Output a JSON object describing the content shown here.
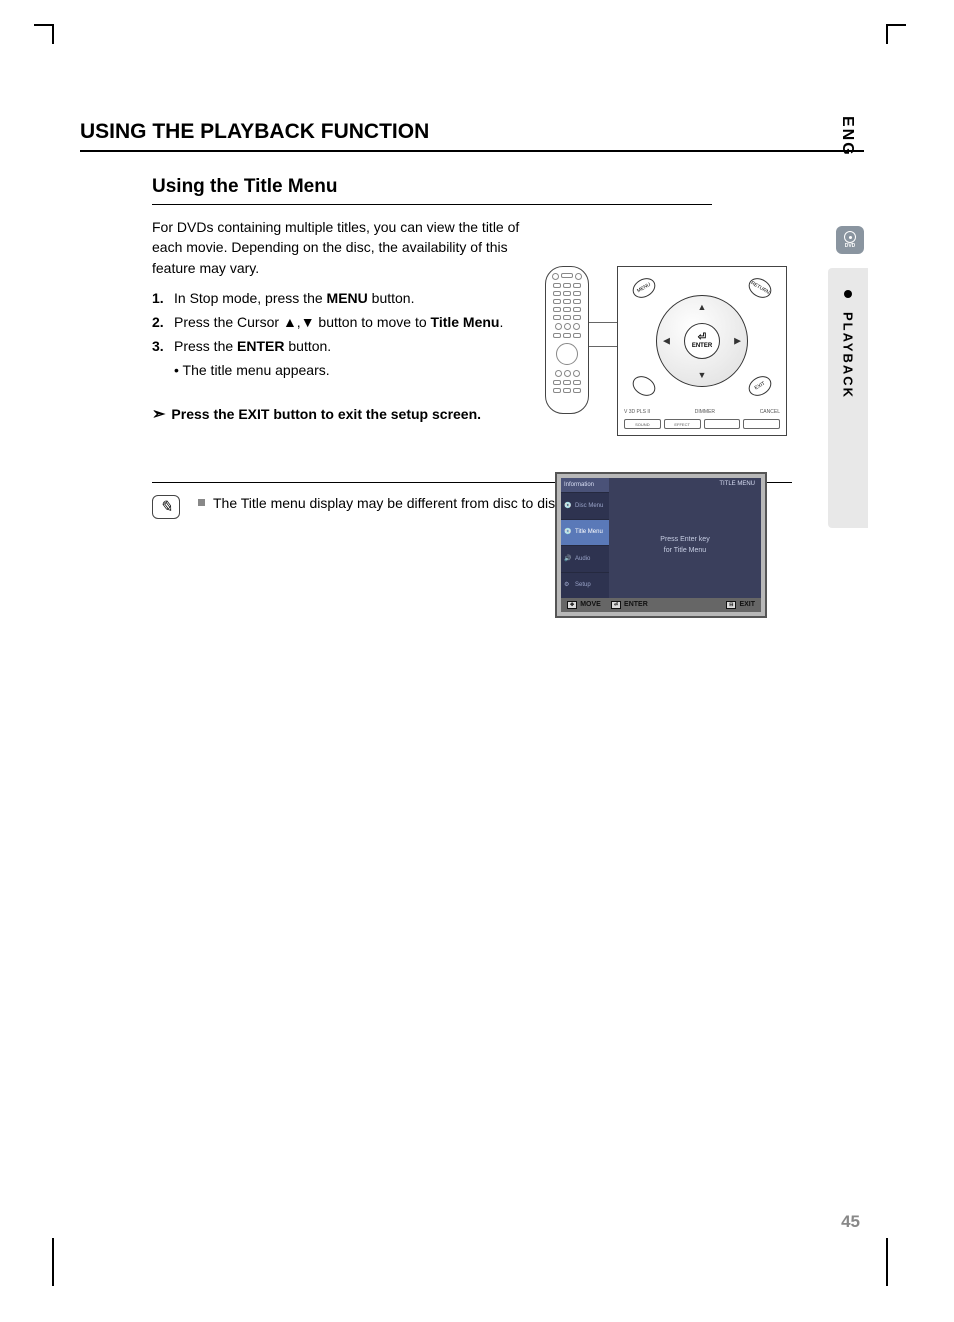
{
  "lang_tab": "ENG",
  "side_tab": "PLAYBACK",
  "dvd_badge": "DVD",
  "heading1": "USING THE PLAYBACK FUNCTION",
  "heading2": "Using the Title Menu",
  "intro": "For DVDs containing multiple titles, you can view the title of each movie. Depending on the disc, the availability of this feature may vary.",
  "steps": [
    {
      "num": "1.",
      "pre": "In Stop mode, press the ",
      "bold": "MENU",
      "post": " button."
    },
    {
      "num": "2.",
      "pre": "Press the Cursor ",
      "mid": ",",
      "bold": "Title Menu",
      "post_pre": " button to move to ",
      "post": "."
    },
    {
      "num": "3.",
      "pre": "Press the ",
      "bold": "ENTER",
      "post": " button."
    }
  ],
  "sub_bullet": "• The title menu appears.",
  "exit_line": "Press the EXIT button to exit the setup screen.",
  "dpad": {
    "enter": "ENTER",
    "menu": "MENU",
    "return": "RETURN",
    "exit": "EXIT",
    "bottom_labels": [
      "V 3D PLS II",
      "DIMMER",
      "CANCEL"
    ],
    "bottom_buttons": [
      "SOUND",
      "EFFECT",
      "",
      ""
    ]
  },
  "tv": {
    "header": "Information",
    "title_right": "TITLE MENU",
    "side_items": [
      "Disc Menu",
      "Title Menu",
      "Audio",
      "Setup"
    ],
    "main_line1": "Press Enter key",
    "main_line2": "for Title Menu",
    "footer": {
      "move": "MOVE",
      "enter": "ENTER",
      "exit": "EXIT"
    }
  },
  "note": "The Title menu display may be different from disc to disc.",
  "page_num": "45"
}
